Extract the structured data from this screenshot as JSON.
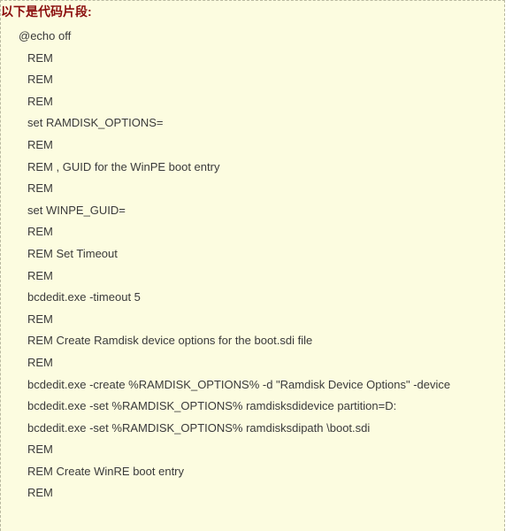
{
  "snippet": {
    "title": "以下是代码片段:",
    "title_color": "#8b0e0e",
    "background_color": "#fcfce0",
    "border_color": "#b9b9a0",
    "text_color": "#3a3a3a",
    "lines": [
      {
        "text": "@echo off",
        "indent": 0
      },
      {
        "text": "REM",
        "indent": 1
      },
      {
        "text": "REM",
        "indent": 1
      },
      {
        "text": "REM",
        "indent": 1
      },
      {
        "text": "set RAMDISK_OPTIONS=",
        "indent": 1
      },
      {
        "text": "REM",
        "indent": 1
      },
      {
        "text": "REM , GUID for the WinPE boot entry",
        "indent": 1
      },
      {
        "text": "REM",
        "indent": 1
      },
      {
        "text": "set WINPE_GUID=",
        "indent": 1
      },
      {
        "text": "REM",
        "indent": 1
      },
      {
        "text": "REM Set Timeout",
        "indent": 1
      },
      {
        "text": "REM",
        "indent": 1
      },
      {
        "text": "bcdedit.exe -timeout 5",
        "indent": 1
      },
      {
        "text": "REM",
        "indent": 1
      },
      {
        "text": "REM Create Ramdisk device options for the boot.sdi file",
        "indent": 1
      },
      {
        "text": "REM",
        "indent": 1
      },
      {
        "text": "bcdedit.exe -create %RAMDISK_OPTIONS% -d \"Ramdisk Device Options\" -device",
        "indent": 1
      },
      {
        "text": "bcdedit.exe -set %RAMDISK_OPTIONS% ramdisksdidevice partition=D:",
        "indent": 1
      },
      {
        "text": "bcdedit.exe -set %RAMDISK_OPTIONS% ramdisksdipath \\boot.sdi",
        "indent": 1
      },
      {
        "text": "REM",
        "indent": 1
      },
      {
        "text": "REM Create WinRE boot entry",
        "indent": 1
      },
      {
        "text": "REM",
        "indent": 1
      }
    ]
  }
}
